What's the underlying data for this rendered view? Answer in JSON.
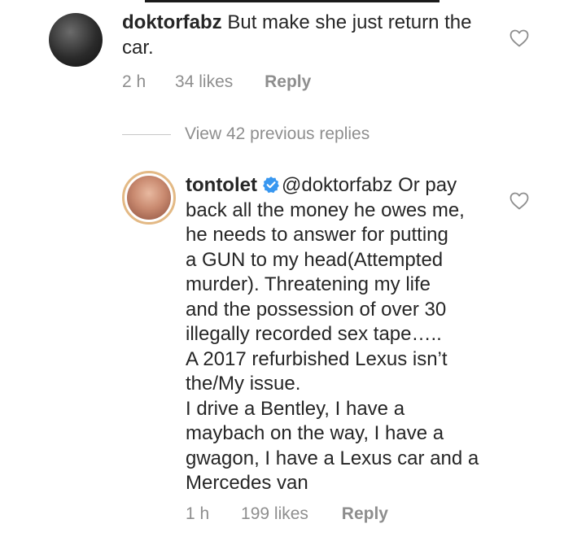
{
  "comments": [
    {
      "username": "doktorfabz",
      "text_lines": [
        "But make she just return the",
        "car."
      ],
      "time": "2 h",
      "likes": "34 likes",
      "reply_label": "Reply"
    },
    {
      "username": "tontolet",
      "verified": true,
      "mention": "@doktorfabz",
      "text_lines": [
        "Or pay",
        "back all the money he owes me,",
        "he needs to answer for putting",
        "a GUN to my head(Attempted",
        "murder). Threatening my life",
        "and the possession of over 30",
        "illegally recorded sex tape…..",
        "A 2017 refurbished Lexus isn’t",
        "the/My issue.",
        "I drive a Bentley, I have a",
        "maybach on the way, I have a",
        "gwagon, I have a Lexus car and a",
        "Mercedes van"
      ],
      "time": "1 h",
      "likes": "199 likes",
      "reply_label": "Reply"
    }
  ],
  "view_replies": {
    "label": "View 42 previous replies"
  },
  "icons": {
    "like": "heart-outline-icon",
    "verified": "verified-badge-icon"
  },
  "colors": {
    "text": "#262626",
    "meta": "#8e8e8e",
    "verified": "#3897f0",
    "divider": "#c7c7c7"
  }
}
